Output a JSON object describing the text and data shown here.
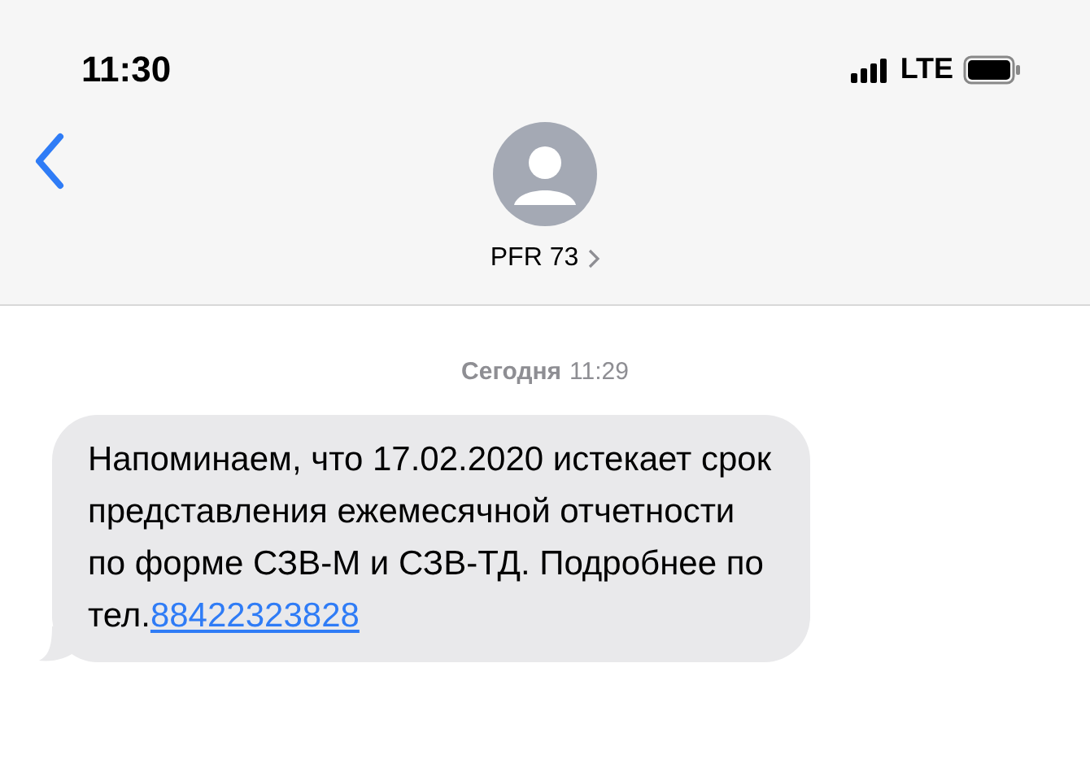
{
  "status_bar": {
    "time": "11:30",
    "network": "LTE"
  },
  "header": {
    "contact_name": "PFR 73"
  },
  "timestamp": {
    "day": "Сегодня",
    "time": "11:29"
  },
  "message": {
    "text": "Напоминаем, что 17.02.2020 истекает срок представления ежемесячной отчетности по форме СЗВ-М и СЗВ-ТД. Подробнее по тел.",
    "link": "88422323828"
  }
}
